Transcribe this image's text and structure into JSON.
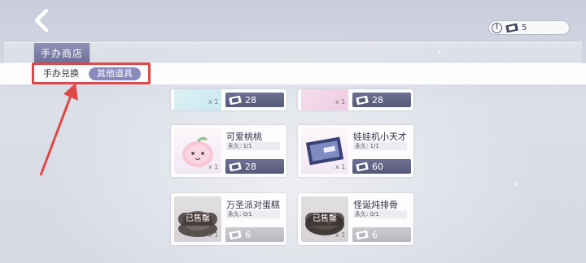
{
  "header": {
    "back_icon": "chevron-left-icon",
    "currency": {
      "info_icon": "exclamation-icon",
      "currency_icon": "ticket-icon",
      "amount": "5"
    }
  },
  "title_tab": {
    "label": "手办商店"
  },
  "tabs": [
    {
      "label": "手办兑换",
      "active": false
    },
    {
      "label": "其他道具",
      "active": true
    }
  ],
  "annotation": {
    "highlight_color": "#e04848"
  },
  "items": [
    {
      "name": "",
      "duration": "",
      "quantity": "x 1",
      "price": "28",
      "sold": false
    },
    {
      "name": "",
      "duration": "",
      "quantity": "x 1",
      "price": "28",
      "sold": false
    },
    {
      "name": "可爱桃桃",
      "duration": "永久: 1/1",
      "quantity": "x 1",
      "price": "28",
      "sold": false
    },
    {
      "name": "娃娃机小天才",
      "duration": "永久: 1/1",
      "quantity": "x 1",
      "price": "60",
      "sold": false
    },
    {
      "name": "万圣派对蛋糕",
      "duration": "永久: 0/1",
      "quantity": "x 1",
      "price": "6",
      "sold": true,
      "sold_label": "已售罄"
    },
    {
      "name": "怪诞炖排骨",
      "duration": "永久: 0/1",
      "quantity": "x 1",
      "price": "6",
      "sold": true,
      "sold_label": "已售罄"
    }
  ]
}
